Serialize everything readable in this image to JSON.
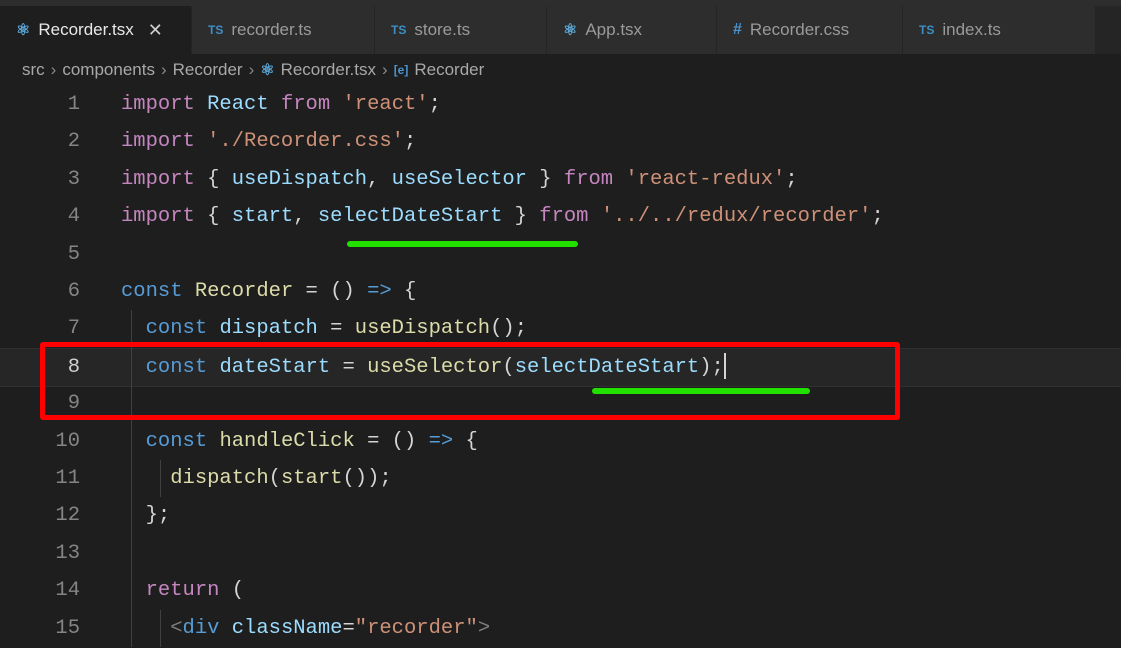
{
  "tabs": [
    {
      "icon": "react-icon",
      "label": "Recorder.tsx",
      "active": true
    },
    {
      "icon": "ts-icon",
      "label": "recorder.ts"
    },
    {
      "icon": "ts-icon",
      "label": "store.ts"
    },
    {
      "icon": "react-icon",
      "label": "App.tsx"
    },
    {
      "icon": "css-icon",
      "label": "Recorder.css"
    },
    {
      "icon": "ts-icon",
      "label": "index.ts"
    }
  ],
  "icons": {
    "ts": "TS",
    "css": "#",
    "react": "⚛",
    "close": "✕",
    "sep": "›",
    "symbol": "[e]"
  },
  "breadcrumb": [
    "src",
    "components",
    "Recorder",
    "Recorder.tsx",
    "Recorder"
  ],
  "colors": {
    "annotation_box": "#ff0000",
    "underline": "#22e000"
  },
  "current_line": 8,
  "lines": [
    {
      "n": "1",
      "tokens": [
        [
          "kw",
          "import"
        ],
        [
          "pn",
          " "
        ],
        [
          "id",
          "React"
        ],
        [
          "pn",
          " "
        ],
        [
          "kw",
          "from"
        ],
        [
          "pn",
          " "
        ],
        [
          "str",
          "'react'"
        ],
        [
          "pn",
          ";"
        ]
      ]
    },
    {
      "n": "2",
      "tokens": [
        [
          "kw",
          "import"
        ],
        [
          "pn",
          " "
        ],
        [
          "str",
          "'./Recorder.css'"
        ],
        [
          "pn",
          ";"
        ]
      ]
    },
    {
      "n": "3",
      "tokens": [
        [
          "kw",
          "import"
        ],
        [
          "pn",
          " { "
        ],
        [
          "id",
          "useDispatch"
        ],
        [
          "pn",
          ", "
        ],
        [
          "id",
          "useSelector"
        ],
        [
          "pn",
          " } "
        ],
        [
          "kw",
          "from"
        ],
        [
          "pn",
          " "
        ],
        [
          "str",
          "'react-redux'"
        ],
        [
          "pn",
          ";"
        ]
      ]
    },
    {
      "n": "4",
      "tokens": [
        [
          "kw",
          "import"
        ],
        [
          "pn",
          " { "
        ],
        [
          "id",
          "start"
        ],
        [
          "pn",
          ", "
        ],
        [
          "id",
          "selectDateStart"
        ],
        [
          "pn",
          " } "
        ],
        [
          "kw",
          "from"
        ],
        [
          "pn",
          " "
        ],
        [
          "str",
          "'../../redux/recorder'"
        ],
        [
          "pn",
          ";"
        ]
      ]
    },
    {
      "n": "5",
      "tokens": []
    },
    {
      "n": "6",
      "tokens": [
        [
          "st",
          "const"
        ],
        [
          "pn",
          " "
        ],
        [
          "fn",
          "Recorder"
        ],
        [
          "pn",
          " = () "
        ],
        [
          "st",
          "=>"
        ],
        [
          "pn",
          " {"
        ]
      ]
    },
    {
      "n": "7",
      "tokens": [
        [
          "pn",
          "  "
        ],
        [
          "st",
          "const"
        ],
        [
          "pn",
          " "
        ],
        [
          "id",
          "dispatch"
        ],
        [
          "pn",
          " = "
        ],
        [
          "fn",
          "useDispatch"
        ],
        [
          "pn",
          "();"
        ]
      ]
    },
    {
      "n": "8",
      "tokens": [
        [
          "pn",
          "  "
        ],
        [
          "st",
          "const"
        ],
        [
          "pn",
          " "
        ],
        [
          "id",
          "dateStart"
        ],
        [
          "pn",
          " = "
        ],
        [
          "fn",
          "useSelector"
        ],
        [
          "pn",
          "("
        ],
        [
          "id",
          "selectDateStart"
        ],
        [
          "pn",
          ");"
        ]
      ]
    },
    {
      "n": "9",
      "tokens": []
    },
    {
      "n": "10",
      "tokens": [
        [
          "pn",
          "  "
        ],
        [
          "st",
          "const"
        ],
        [
          "pn",
          " "
        ],
        [
          "fn",
          "handleClick"
        ],
        [
          "pn",
          " = () "
        ],
        [
          "st",
          "=>"
        ],
        [
          "pn",
          " {"
        ]
      ]
    },
    {
      "n": "11",
      "tokens": [
        [
          "pn",
          "    "
        ],
        [
          "fn",
          "dispatch"
        ],
        [
          "pn",
          "("
        ],
        [
          "fn",
          "start"
        ],
        [
          "pn",
          "());"
        ]
      ]
    },
    {
      "n": "12",
      "tokens": [
        [
          "pn",
          "  };"
        ]
      ]
    },
    {
      "n": "13",
      "tokens": []
    },
    {
      "n": "14",
      "tokens": [
        [
          "pn",
          "  "
        ],
        [
          "kw",
          "return"
        ],
        [
          "pn",
          " ("
        ]
      ]
    },
    {
      "n": "15",
      "tokens": [
        [
          "pn",
          "    "
        ],
        [
          "tag",
          "<"
        ],
        [
          "tn",
          "div"
        ],
        [
          "pn",
          " "
        ],
        [
          "at",
          "className"
        ],
        [
          "pn",
          "="
        ],
        [
          "str",
          "\"recorder\""
        ],
        [
          "tag",
          ">"
        ]
      ]
    }
  ]
}
